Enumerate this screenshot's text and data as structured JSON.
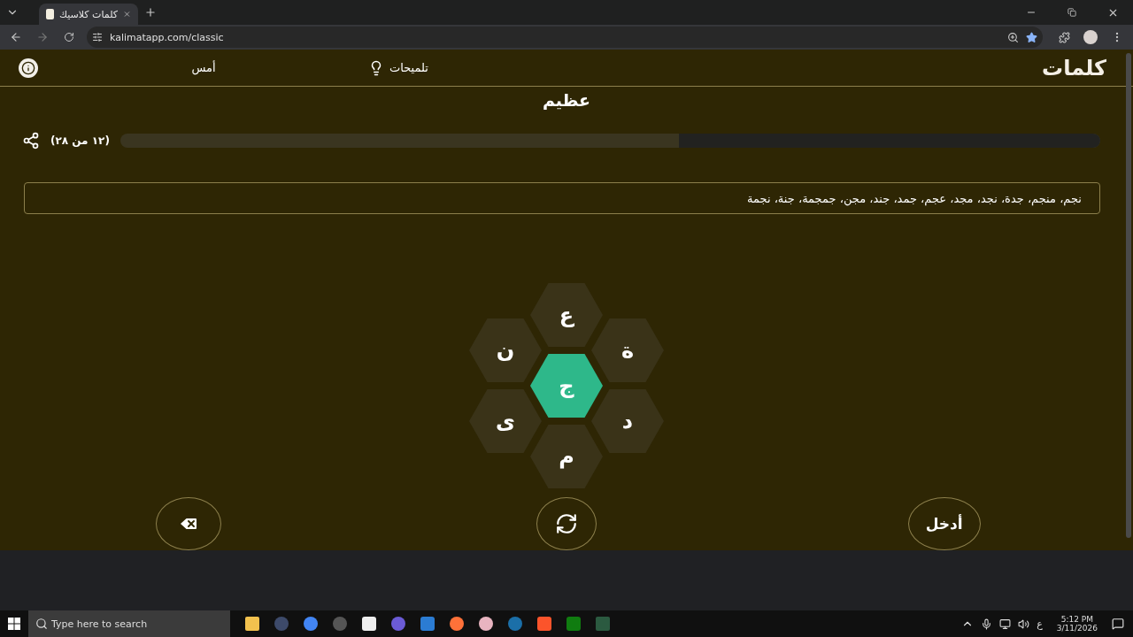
{
  "browser": {
    "tab_title": "كلمات كلاسيك",
    "url": "kalimatapp.com/classic"
  },
  "header": {
    "logo": "كلمات",
    "hints_label": "تلميحات",
    "yesterday_label": "أمس"
  },
  "rank": "عظيم",
  "progress": {
    "count": "(١٢ من ٢٨)",
    "level": 0.43
  },
  "found_words": "نجم، منجم، جدة، نجد، مجد، عجم، جمد، جند، مجن، جمجمة، جنة، نجمة",
  "letters": [
    {
      "letter": "ع",
      "kind": "outer"
    },
    {
      "letter": "ة",
      "kind": "outer"
    },
    {
      "letter": "ن",
      "kind": "outer"
    },
    {
      "letter": "ج",
      "kind": "center"
    },
    {
      "letter": "د",
      "kind": "outer"
    },
    {
      "letter": "ى",
      "kind": "outer"
    },
    {
      "letter": "م",
      "kind": "outer"
    }
  ],
  "enter_button": "أدخل",
  "taskbar": {
    "search_placeholder": "Type here to search",
    "language": "ع",
    "time": "5:12 PM",
    "date": "3/11/2026"
  }
}
